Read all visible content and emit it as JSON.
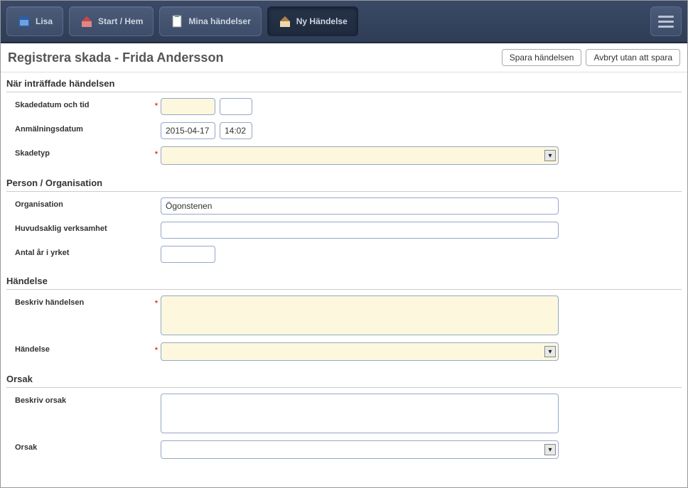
{
  "nav": {
    "lisa": "Lisa",
    "start": "Start / Hem",
    "mina": "Mina händelser",
    "ny": "Ny Händelse"
  },
  "header": {
    "title": "Registrera skada - Frida Andersson",
    "save": "Spara händelsen",
    "cancel": "Avbryt utan att spara"
  },
  "sections": {
    "when": "När inträffade händelsen",
    "person": "Person / Organisation",
    "event": "Händelse",
    "cause": "Orsak"
  },
  "labels": {
    "skadedatum": "Skadedatum och tid",
    "anmalning": "Anmälningsdatum",
    "skadetyp": "Skadetyp",
    "organisation": "Organisation",
    "huvudverk": "Huvudsaklig verksamhet",
    "antalar": "Antal år i yrket",
    "beskrivhandelse": "Beskriv händelsen",
    "handelse": "Händelse",
    "beskrivorsak": "Beskriv orsak",
    "orsak": "Orsak"
  },
  "values": {
    "skadedatum_date": "",
    "skadedatum_time": "",
    "anmalning_date": "2015-04-17",
    "anmalning_time": "14:02",
    "skadetyp": "",
    "organisation": "Ögonstenen",
    "huvudverk": "",
    "antalar": "",
    "beskrivhandelse": "",
    "handelse": "",
    "beskrivorsak": "",
    "orsak": ""
  }
}
